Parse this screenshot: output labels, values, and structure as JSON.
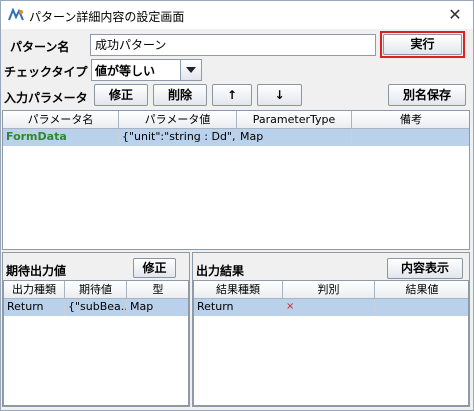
{
  "window": {
    "title": "パターン詳細内容の設定画面",
    "close_glyph": "✕",
    "icon": "app-logo-icon"
  },
  "form": {
    "pattern_name_label": "パターン名",
    "pattern_name_value": "成功パターン",
    "execute_button": "実行",
    "check_type_label": "チェックタイプ",
    "check_type_value": "値が等しい",
    "input_param_label": "入力パラメータ",
    "edit_button": "修正",
    "delete_button": "削除",
    "up_button": "↑",
    "down_button": "↓",
    "save_as_button": "別名保存"
  },
  "param_table": {
    "columns": [
      "パラメータ名",
      "パラメータ値",
      "ParameterType",
      "備考"
    ],
    "rows": [
      [
        "FormData",
        "{\"unit\":\"string : Dd\",\"...",
        "Map",
        ""
      ]
    ]
  },
  "expected_panel": {
    "title": "期待出力値",
    "edit_button": "修正",
    "columns": [
      "出力種類",
      "期待値",
      "型"
    ],
    "rows": [
      [
        "Return",
        "{\"subBea...",
        "Map"
      ]
    ]
  },
  "result_panel": {
    "title": "出力結果",
    "show_button": "内容表示",
    "columns": [
      "結果種類",
      "判別",
      "結果値"
    ],
    "rows": [
      [
        "Return",
        "×",
        ""
      ]
    ]
  },
  "colors": {
    "execute_highlight": "#e02020",
    "param_name_text": "#2f8a2f",
    "selection_row": "#b9d1ea",
    "fail_mark": "#d02020"
  }
}
